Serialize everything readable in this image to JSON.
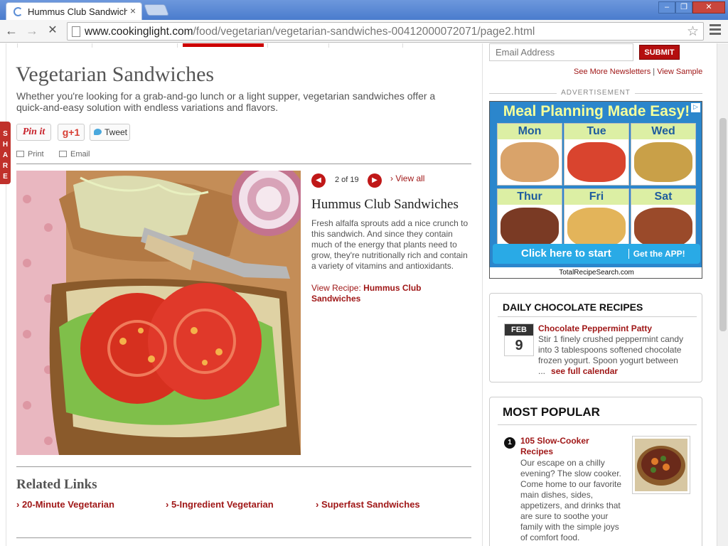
{
  "browser": {
    "tab_title": "Hummus Club Sandwiche",
    "url_domain": "www.cookinglight.com",
    "url_path": "/food/vegetarian/vegetarian-sandwiches-00412000072071/page2.html",
    "close_glyph": "×",
    "min_glyph": "‒",
    "max_glyph": "❐",
    "win_close_glyph": "✕",
    "back_glyph": "←",
    "forward_glyph": "→",
    "stop_glyph": "✕",
    "star_glyph": "☆"
  },
  "page": {
    "title": "Vegetarian Sandwiches",
    "intro": "Whether you're looking for a grab-and-go lunch or a light supper, vegetarian sandwiches offer a quick-and-easy solution with endless variations and flavors.",
    "share_tab": "SHARE",
    "social": {
      "pinit": "Pin it",
      "gplus": "g+1",
      "tweet": "Tweet"
    },
    "utility": {
      "print": "Print",
      "email": "Email"
    }
  },
  "slide": {
    "counter": "2 of 19",
    "prev_glyph": "◀",
    "next_glyph": "▶",
    "view_all": "› View all",
    "title": "Hummus Club Sandwiches",
    "description": "Fresh alfalfa sprouts add a nice crunch to this sandwich. And since they contain much of the energy that plants need to grow, they're nutritionally rich and contain a variety of vitamins and antioxidants.",
    "view_recipe_label": "View Recipe:",
    "view_recipe_link": "Hummus Club Sandwiches"
  },
  "related": {
    "heading": "Related Links",
    "links": [
      "› 20-Minute Vegetarian",
      "› 5-Ingredient Vegetarian",
      "› Superfast Sandwiches"
    ]
  },
  "sidebar": {
    "email_placeholder": "Email Address",
    "submit_label": "SUBMIT",
    "see_more": "See More Newsletters",
    "separator": "|",
    "view_sample": "View Sample",
    "ad_label": "ADVERTISEMENT",
    "ad": {
      "headline": "Meal Planning Made Easy!",
      "days": [
        "Mon",
        "Tue",
        "Wed",
        "Thur",
        "Fri",
        "Sat"
      ],
      "cta": "Click here to start",
      "cta_app": "Get the APP!",
      "footer": "TotalRecipeSearch.com",
      "adchoice": "▷"
    },
    "chocolate": {
      "heading": "DAILY CHOCOLATE RECIPES",
      "month": "FEB",
      "day": "9",
      "title": "Chocolate Peppermint Patty",
      "text": "Stir 1 finely crushed peppermint candy into 3 tablespoons softened chocolate frozen yogurt. Spoon yogurt between ...",
      "calendar_link": "see full calendar"
    },
    "popular": {
      "heading": "MOST POPULAR",
      "items": [
        {
          "rank": "1",
          "title": "105 Slow-Cooker Recipes",
          "text": "Our escape on a chilly evening? The slow cooker. Come home to our favorite main dishes, sides, appetizers, and drinks that are sure to soothe your family with the simple joys of comfort food."
        }
      ]
    }
  },
  "colors": {
    "accent": "#a01818",
    "share": "#c0312b",
    "ad_blue": "#2b86cc"
  }
}
